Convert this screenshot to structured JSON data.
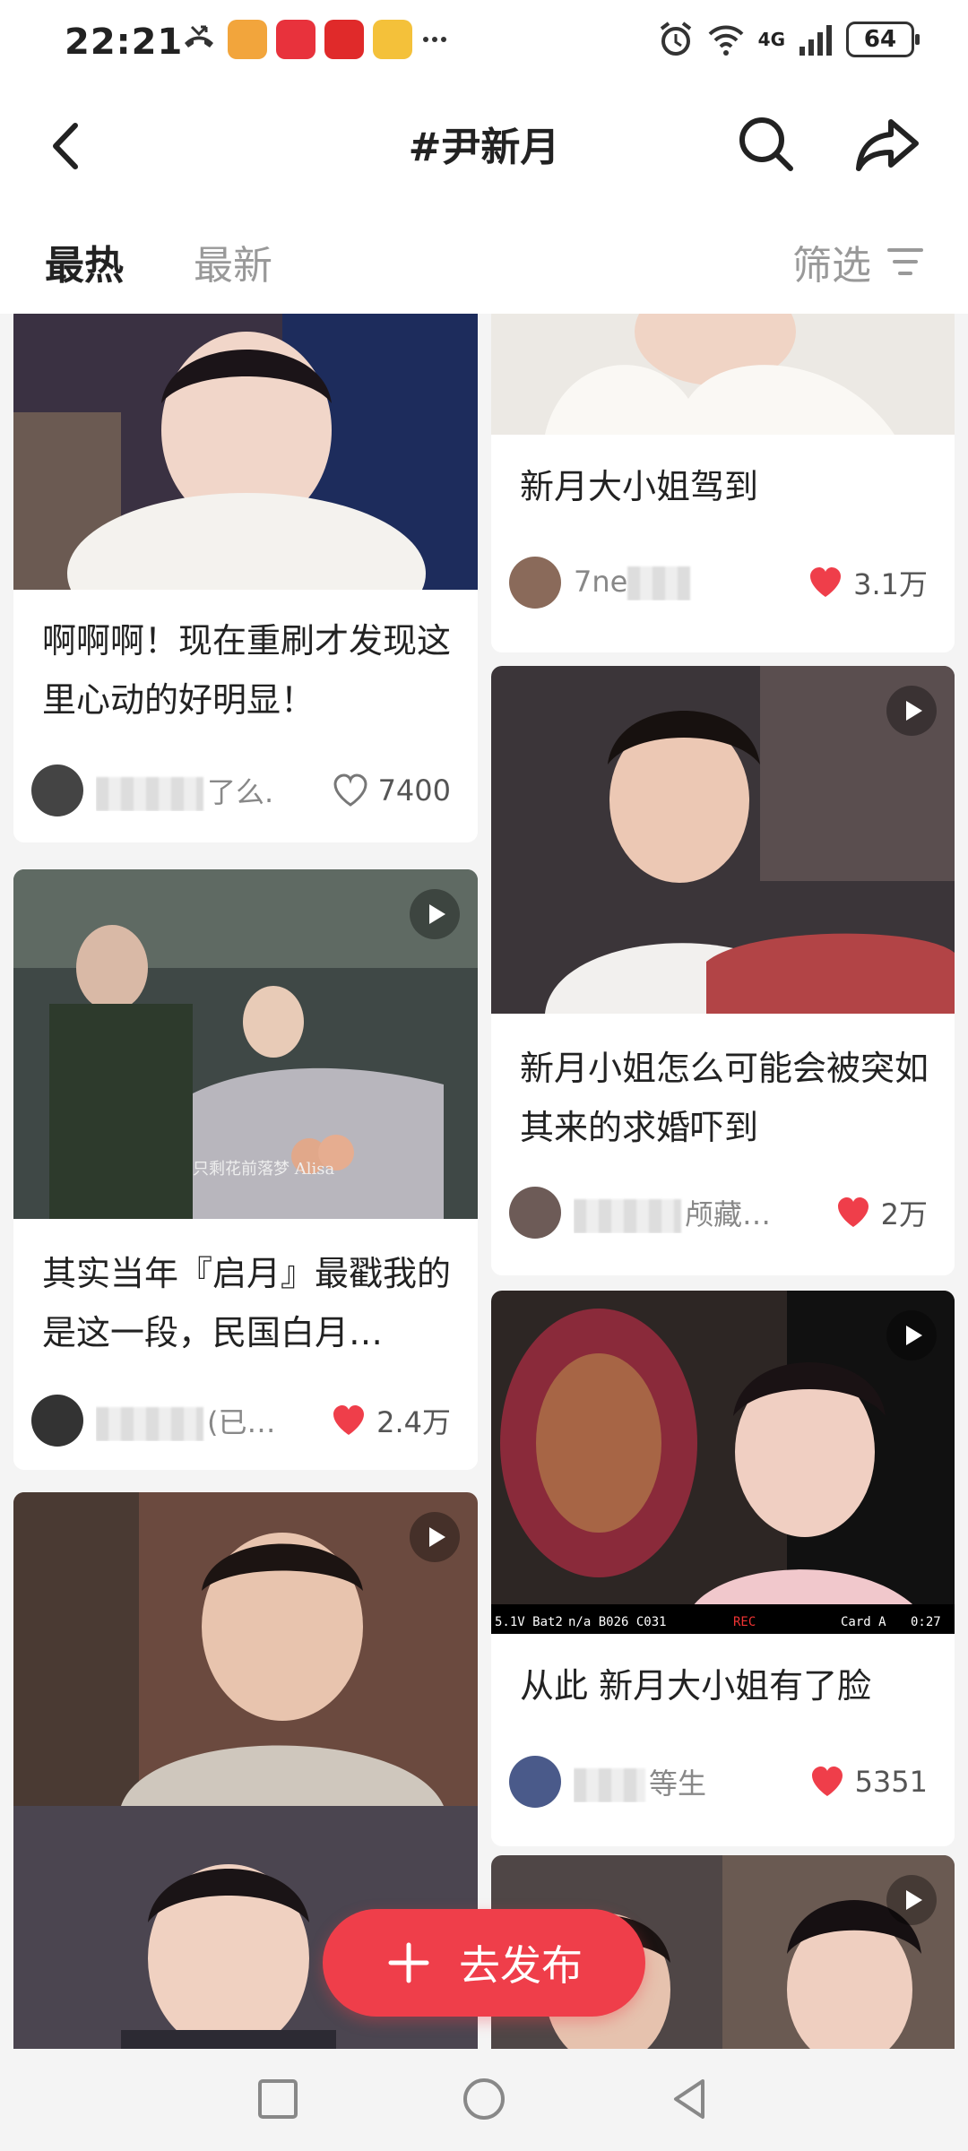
{
  "status_bar": {
    "time": "22:21",
    "network": "4G",
    "battery": "64"
  },
  "header": {
    "title": "#尹新月"
  },
  "tabs": [
    {
      "label": "最热",
      "active": true
    },
    {
      "label": "最新",
      "active": false
    }
  ],
  "filter": {
    "label": "筛选"
  },
  "posts": [
    {
      "title": "",
      "author": "",
      "likes": "",
      "liked": false,
      "video": false
    },
    {
      "title": "新月大小姐驾到",
      "author": "7ne",
      "likes": "3.1万",
      "liked": true,
      "video": false
    },
    {
      "title": "啊啊啊！现在重刷才发现这里心动的好明显！",
      "author": "了么.",
      "likes": "7400",
      "liked": false,
      "video": false
    },
    {
      "title": "",
      "author": "",
      "likes": "",
      "liked": false,
      "video": true,
      "caption": "只剩花前落梦 Alisa"
    },
    {
      "title": "新月小姐怎么可能会被突如其来的求婚吓到",
      "author": "颅藏…",
      "likes": "2万",
      "liked": true,
      "video": true
    },
    {
      "title": "其实当年『启月』最戳我的是这一段，民国白月…",
      "author": "(已…",
      "likes": "2.4万",
      "liked": true,
      "video": true
    },
    {
      "title": "从此 新月大小姐有了脸",
      "author": "等生",
      "likes": "5351",
      "liked": true,
      "video": true,
      "osd": [
        "5.1V Bat2",
        "n/a B026 C031",
        "REC",
        "Card A",
        "0:27"
      ]
    },
    {
      "title": "",
      "author": "",
      "likes": "",
      "liked": false,
      "video": true
    }
  ],
  "publish": {
    "label": "去发布"
  },
  "colors": {
    "accent": "#ef3e4a",
    "heart": "#ef3e4a",
    "background": "#f4f4f4"
  }
}
